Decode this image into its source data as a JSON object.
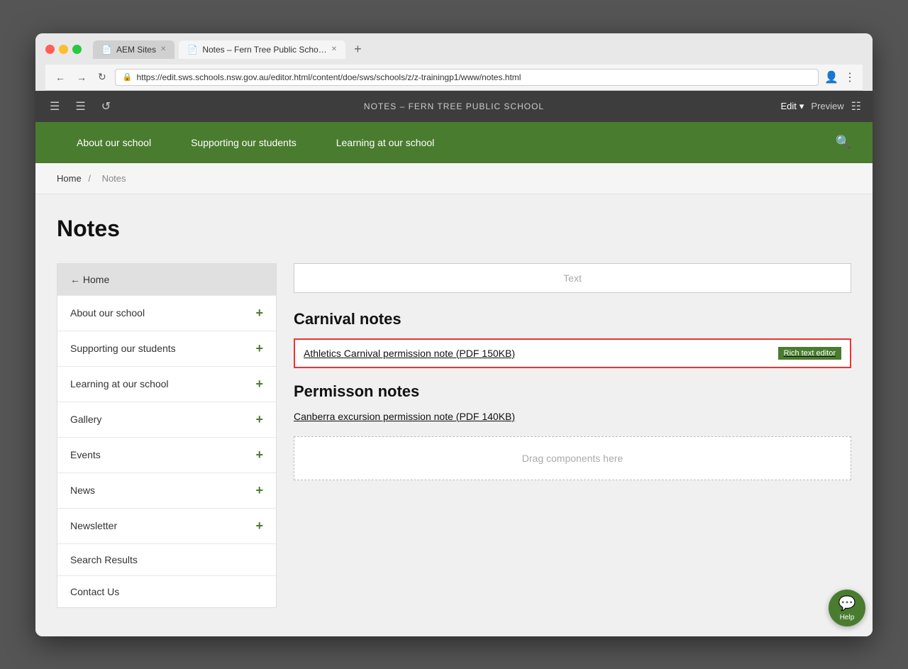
{
  "browser": {
    "tabs": [
      {
        "id": "tab1",
        "icon": "📄",
        "title": "AEM Sites",
        "active": false
      },
      {
        "id": "tab2",
        "icon": "📄",
        "title": "Notes – Fern Tree Public Scho…",
        "active": true
      }
    ],
    "url": "https://edit.sws.schools.nsw.gov.au/editor.html/content/doe/sws/schools/z/z-trainingp1/www/notes.html"
  },
  "aem": {
    "toolbar_title": "NOTES – FERN TREE PUBLIC SCHOOL",
    "edit_label": "Edit",
    "preview_label": "Preview"
  },
  "site_nav": {
    "items": [
      {
        "id": "about",
        "label": "About our school"
      },
      {
        "id": "supporting",
        "label": "Supporting our students"
      },
      {
        "id": "learning",
        "label": "Learning at our school"
      }
    ]
  },
  "breadcrumb": {
    "home": "Home",
    "separator": "/",
    "current": "Notes"
  },
  "page": {
    "title": "Notes"
  },
  "sidebar": {
    "home_label": "← Home",
    "items": [
      {
        "id": "about",
        "label": "About our school"
      },
      {
        "id": "supporting",
        "label": "Supporting our students"
      },
      {
        "id": "learning",
        "label": "Learning at our school"
      },
      {
        "id": "gallery",
        "label": "Gallery"
      },
      {
        "id": "events",
        "label": "Events"
      },
      {
        "id": "news",
        "label": "News"
      },
      {
        "id": "newsletter",
        "label": "Newsletter"
      },
      {
        "id": "search",
        "label": "Search Results"
      },
      {
        "id": "contact",
        "label": "Contact Us"
      }
    ]
  },
  "main": {
    "text_placeholder": "Text",
    "carnival_section": {
      "title": "Carnival notes",
      "link_text": "Athletics Carnival permission note (PDF 150KB)",
      "badge_text": "Rich text editor"
    },
    "permission_section": {
      "title": "Permisson notes",
      "link_text": "Canberra excursion permission note (PDF 140KB)"
    },
    "drag_zone": "Drag components here"
  },
  "help": {
    "label": "Help"
  }
}
